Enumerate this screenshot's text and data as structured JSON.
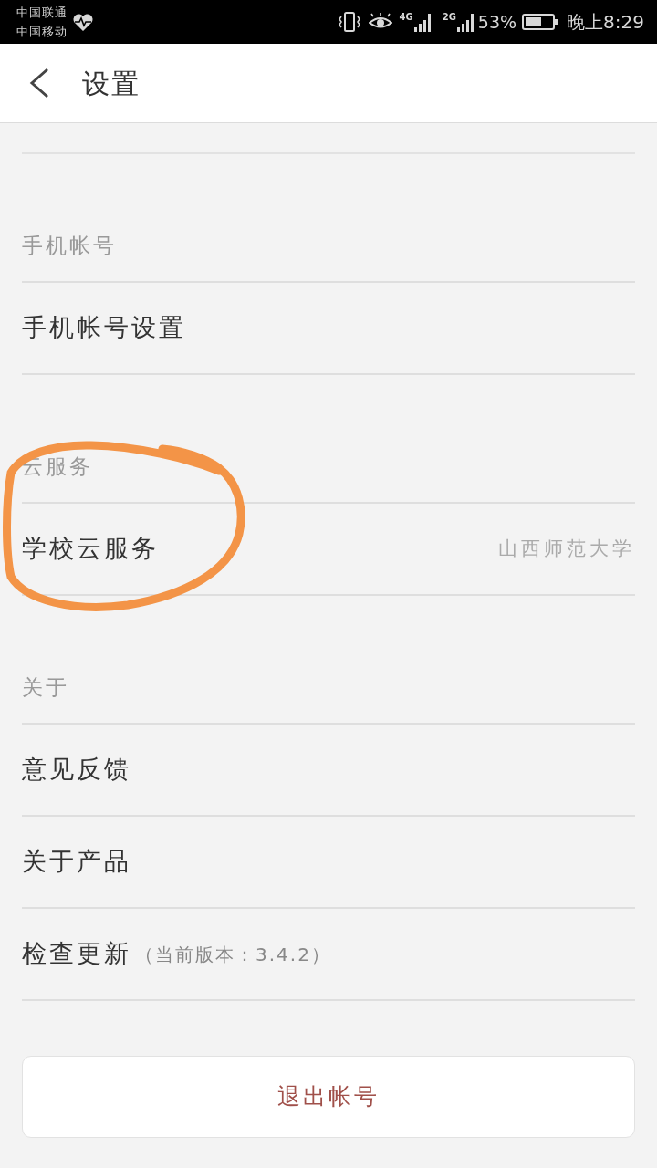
{
  "status_bar": {
    "carriers": [
      "中国联通",
      "中国移动"
    ],
    "network_types": [
      "4G",
      "2G"
    ],
    "battery": "53%",
    "time": "晚上8:29"
  },
  "header": {
    "title": "设置"
  },
  "sections": [
    {
      "title": "手机帐号",
      "items": [
        {
          "label": "手机帐号设置"
        }
      ]
    },
    {
      "title": "云服务",
      "items": [
        {
          "label": "学校云服务",
          "value": "山西师范大学"
        }
      ]
    },
    {
      "title": "关于",
      "items": [
        {
          "label": "意见反馈"
        },
        {
          "label": "关于产品"
        },
        {
          "label": "检查更新",
          "note": "（当前版本：3.4.2）"
        }
      ]
    }
  ],
  "logout_button": {
    "label": "退出帐号"
  },
  "annotations": [
    {
      "kind": "circle"
    }
  ]
}
